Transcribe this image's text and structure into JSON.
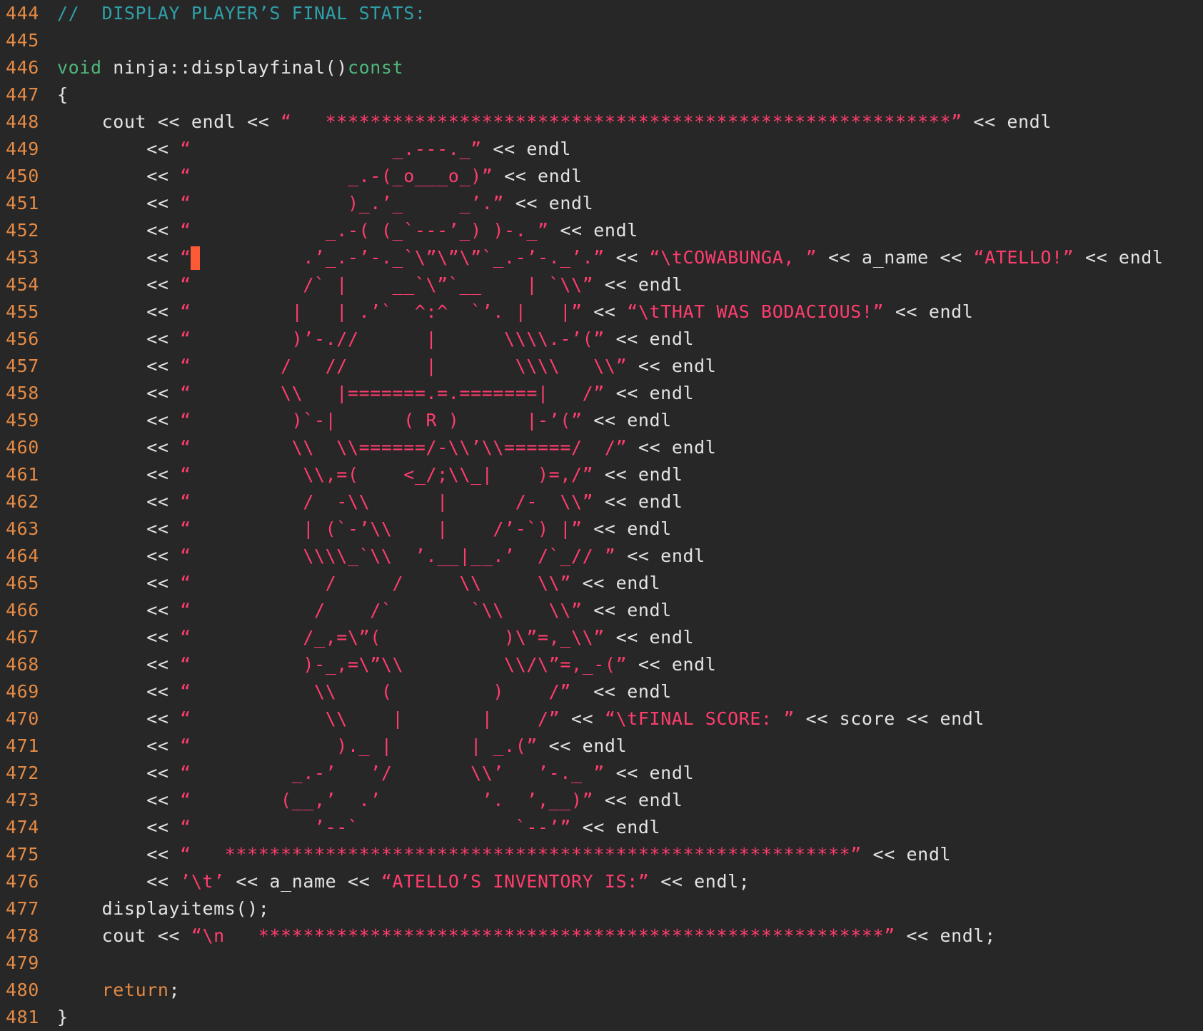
{
  "editor": {
    "cursor_line": 453,
    "colors": {
      "background": "#272727",
      "line_number": "#e48a45",
      "plain": "#e3e3e3",
      "keyword": "#4fb77b",
      "keyword_return": "#e48a45",
      "string": "#ff3d6d",
      "comment": "#2f9fa7",
      "cursor": "#ff5a36"
    },
    "lines": [
      {
        "n": "444",
        "tokens": [
          {
            "t": "comment",
            "v": "//  DISPLAY PLAYER’S FINAL STATS:"
          }
        ]
      },
      {
        "n": "445",
        "tokens": []
      },
      {
        "n": "446",
        "tokens": [
          {
            "t": "kw",
            "v": "void"
          },
          {
            "t": "plain",
            "v": " ninja::displayfinal()"
          },
          {
            "t": "kw",
            "v": "const"
          }
        ]
      },
      {
        "n": "447",
        "tokens": [
          {
            "t": "plain",
            "v": "{"
          }
        ]
      },
      {
        "n": "448",
        "tokens": [
          {
            "t": "plain",
            "v": "    cout << endl << "
          },
          {
            "t": "str",
            "v": "“   ********************************************************”"
          },
          {
            "t": "plain",
            "v": " << endl"
          }
        ]
      },
      {
        "n": "449",
        "tokens": [
          {
            "t": "plain",
            "v": "        << "
          },
          {
            "t": "str",
            "v": "“                  _.---._”"
          },
          {
            "t": "plain",
            "v": " << endl"
          }
        ]
      },
      {
        "n": "450",
        "tokens": [
          {
            "t": "plain",
            "v": "        << "
          },
          {
            "t": "str",
            "v": "“              _.-(_o___o_)”"
          },
          {
            "t": "plain",
            "v": " << endl"
          }
        ]
      },
      {
        "n": "451",
        "tokens": [
          {
            "t": "plain",
            "v": "        << "
          },
          {
            "t": "str",
            "v": "“              )_.’_     _’.”"
          },
          {
            "t": "plain",
            "v": " << endl"
          }
        ]
      },
      {
        "n": "452",
        "tokens": [
          {
            "t": "plain",
            "v": "        << "
          },
          {
            "t": "str",
            "v": "“            _.-( (_`---’_) )-._”"
          },
          {
            "t": "plain",
            "v": " << endl"
          }
        ]
      },
      {
        "n": "453",
        "tokens": [
          {
            "t": "plain",
            "v": "        << "
          },
          {
            "t": "str",
            "v": "“          .’_.-’-._`\\”\\”\\”`_.-’-._’.”"
          },
          {
            "t": "plain",
            "v": " << "
          },
          {
            "t": "str",
            "v": "“\\tCOWABUNGA, ”"
          },
          {
            "t": "plain",
            "v": " << a_name << "
          },
          {
            "t": "str",
            "v": "“ATELLO!”"
          },
          {
            "t": "plain",
            "v": " << endl"
          }
        ]
      },
      {
        "n": "454",
        "tokens": [
          {
            "t": "plain",
            "v": "        << "
          },
          {
            "t": "str",
            "v": "“          /` |    __`\\”`__    | `\\\\”"
          },
          {
            "t": "plain",
            "v": " << endl"
          }
        ]
      },
      {
        "n": "455",
        "tokens": [
          {
            "t": "plain",
            "v": "        << "
          },
          {
            "t": "str",
            "v": "“         |   | .’`  ^:^  `’. |   |”"
          },
          {
            "t": "plain",
            "v": " << "
          },
          {
            "t": "str",
            "v": "“\\tTHAT WAS BODACIOUS!”"
          },
          {
            "t": "plain",
            "v": " << endl"
          }
        ]
      },
      {
        "n": "456",
        "tokens": [
          {
            "t": "plain",
            "v": "        << "
          },
          {
            "t": "str",
            "v": "“         )’-.//      |      \\\\\\\\.-’(”"
          },
          {
            "t": "plain",
            "v": " << endl"
          }
        ]
      },
      {
        "n": "457",
        "tokens": [
          {
            "t": "plain",
            "v": "        << "
          },
          {
            "t": "str",
            "v": "“        /   //       |       \\\\\\\\   \\\\”"
          },
          {
            "t": "plain",
            "v": " << endl"
          }
        ]
      },
      {
        "n": "458",
        "tokens": [
          {
            "t": "plain",
            "v": "        << "
          },
          {
            "t": "str",
            "v": "“        \\\\   |=======.=.=======|   /”"
          },
          {
            "t": "plain",
            "v": " << endl"
          }
        ]
      },
      {
        "n": "459",
        "tokens": [
          {
            "t": "plain",
            "v": "        << "
          },
          {
            "t": "str",
            "v": "“         )`-|      ( R )      |-’(”"
          },
          {
            "t": "plain",
            "v": " << endl"
          }
        ]
      },
      {
        "n": "460",
        "tokens": [
          {
            "t": "plain",
            "v": "        << "
          },
          {
            "t": "str",
            "v": "“         \\\\  \\\\======/-\\\\’\\\\======/  /”"
          },
          {
            "t": "plain",
            "v": " << endl"
          }
        ]
      },
      {
        "n": "461",
        "tokens": [
          {
            "t": "plain",
            "v": "        << "
          },
          {
            "t": "str",
            "v": "“          \\\\,=(    <_/;\\\\_|    )=,/”"
          },
          {
            "t": "plain",
            "v": " << endl"
          }
        ]
      },
      {
        "n": "462",
        "tokens": [
          {
            "t": "plain",
            "v": "        << "
          },
          {
            "t": "str",
            "v": "“          /  -\\\\      |      /-  \\\\”"
          },
          {
            "t": "plain",
            "v": " << endl"
          }
        ]
      },
      {
        "n": "463",
        "tokens": [
          {
            "t": "plain",
            "v": "        << "
          },
          {
            "t": "str",
            "v": "“          | (`-’\\\\    |    /’-`) |”"
          },
          {
            "t": "plain",
            "v": " << endl"
          }
        ]
      },
      {
        "n": "464",
        "tokens": [
          {
            "t": "plain",
            "v": "        << "
          },
          {
            "t": "str",
            "v": "“          \\\\\\\\_`\\\\  ’.__|__.’  /`_// ”"
          },
          {
            "t": "plain",
            "v": " << endl"
          }
        ]
      },
      {
        "n": "465",
        "tokens": [
          {
            "t": "plain",
            "v": "        << "
          },
          {
            "t": "str",
            "v": "“            /     /     \\\\     \\\\”"
          },
          {
            "t": "plain",
            "v": " << endl"
          }
        ]
      },
      {
        "n": "466",
        "tokens": [
          {
            "t": "plain",
            "v": "        << "
          },
          {
            "t": "str",
            "v": "“           /    /`       `\\\\    \\\\”"
          },
          {
            "t": "plain",
            "v": " << endl"
          }
        ]
      },
      {
        "n": "467",
        "tokens": [
          {
            "t": "plain",
            "v": "        << "
          },
          {
            "t": "str",
            "v": "“          /_,=\\”(           )\\”=,_\\\\”"
          },
          {
            "t": "plain",
            "v": " << endl"
          }
        ]
      },
      {
        "n": "468",
        "tokens": [
          {
            "t": "plain",
            "v": "        << "
          },
          {
            "t": "str",
            "v": "“          )-_,=\\”\\\\         \\\\/\\”=,_-(”"
          },
          {
            "t": "plain",
            "v": " << endl"
          }
        ]
      },
      {
        "n": "469",
        "tokens": [
          {
            "t": "plain",
            "v": "        << "
          },
          {
            "t": "str",
            "v": "“           \\\\    (         )    /”"
          },
          {
            "t": "plain",
            "v": "  << endl"
          }
        ]
      },
      {
        "n": "470",
        "tokens": [
          {
            "t": "plain",
            "v": "        << "
          },
          {
            "t": "str",
            "v": "“            \\\\    |       |    /”"
          },
          {
            "t": "plain",
            "v": " << "
          },
          {
            "t": "str",
            "v": "“\\tFINAL SCORE: ”"
          },
          {
            "t": "plain",
            "v": " << score << endl"
          }
        ]
      },
      {
        "n": "471",
        "tokens": [
          {
            "t": "plain",
            "v": "        << "
          },
          {
            "t": "str",
            "v": "“             )._ |       | _.(”"
          },
          {
            "t": "plain",
            "v": " << endl"
          }
        ]
      },
      {
        "n": "472",
        "tokens": [
          {
            "t": "plain",
            "v": "        << "
          },
          {
            "t": "str",
            "v": "“         _.-’   ’/       \\\\’   ’-._ ”"
          },
          {
            "t": "plain",
            "v": " << endl"
          }
        ]
      },
      {
        "n": "473",
        "tokens": [
          {
            "t": "plain",
            "v": "        << "
          },
          {
            "t": "str",
            "v": "“        (__,’  .’         ’.  ’,__)”"
          },
          {
            "t": "plain",
            "v": " << endl"
          }
        ]
      },
      {
        "n": "474",
        "tokens": [
          {
            "t": "plain",
            "v": "        << "
          },
          {
            "t": "str",
            "v": "“           ’--`              `--’”"
          },
          {
            "t": "plain",
            "v": " << endl"
          }
        ]
      },
      {
        "n": "475",
        "tokens": [
          {
            "t": "plain",
            "v": "        << "
          },
          {
            "t": "str",
            "v": "“   ********************************************************”"
          },
          {
            "t": "plain",
            "v": " << endl"
          }
        ]
      },
      {
        "n": "476",
        "tokens": [
          {
            "t": "plain",
            "v": "        << "
          },
          {
            "t": "str",
            "v": "’\\t’"
          },
          {
            "t": "plain",
            "v": " << a_name << "
          },
          {
            "t": "str",
            "v": "“ATELLO’S INVENTORY IS:”"
          },
          {
            "t": "plain",
            "v": " << endl;"
          }
        ]
      },
      {
        "n": "477",
        "tokens": [
          {
            "t": "plain",
            "v": "    displayitems();"
          }
        ]
      },
      {
        "n": "478",
        "tokens": [
          {
            "t": "plain",
            "v": "    cout << "
          },
          {
            "t": "str",
            "v": "“\\n   ********************************************************”"
          },
          {
            "t": "plain",
            "v": " << endl;"
          }
        ]
      },
      {
        "n": "479",
        "tokens": []
      },
      {
        "n": "480",
        "tokens": [
          {
            "t": "plain",
            "v": "    "
          },
          {
            "t": "kw2",
            "v": "return"
          },
          {
            "t": "plain",
            "v": ";"
          }
        ]
      },
      {
        "n": "481",
        "tokens": [
          {
            "t": "plain",
            "v": "}"
          }
        ]
      }
    ]
  }
}
